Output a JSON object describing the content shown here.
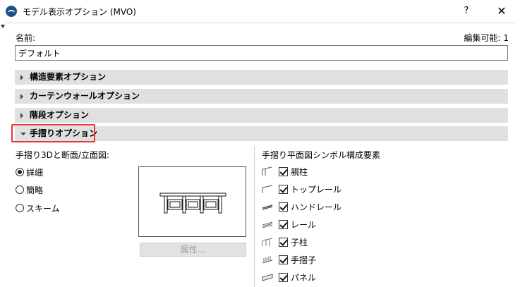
{
  "window": {
    "title": "モデル表示オプション (MVO)",
    "help_label": "?",
    "close_label": "✕"
  },
  "name_section": {
    "label": "名前:",
    "editable": "編集可能: 1",
    "value": "デフォルト"
  },
  "sections": [
    {
      "label": "構造要素オプション",
      "expanded": false
    },
    {
      "label": "カーテンウォールオプション",
      "expanded": false
    },
    {
      "label": "階段オプション",
      "expanded": false
    },
    {
      "label": "手摺りオプション",
      "expanded": true
    }
  ],
  "left_panel": {
    "heading": "手摺り3Dと断面/立面図:",
    "options": [
      {
        "label": "詳細",
        "selected": true
      },
      {
        "label": "簡略",
        "selected": false
      },
      {
        "label": "スキーム",
        "selected": false
      }
    ],
    "attr_button": "属性..."
  },
  "right_panel": {
    "heading": "手摺り平面図シンボル構成要素",
    "items": [
      {
        "label": "親柱",
        "checked": true
      },
      {
        "label": "トップレール",
        "checked": true
      },
      {
        "label": "ハンドレール",
        "checked": true
      },
      {
        "label": "レール",
        "checked": true
      },
      {
        "label": "子柱",
        "checked": true
      },
      {
        "label": "手摺子",
        "checked": true
      },
      {
        "label": "パネル",
        "checked": true
      }
    ]
  },
  "colors": {
    "section_bar": "#e0e0e0",
    "highlight": "#e53935",
    "app_icon": "#1f4f86"
  }
}
